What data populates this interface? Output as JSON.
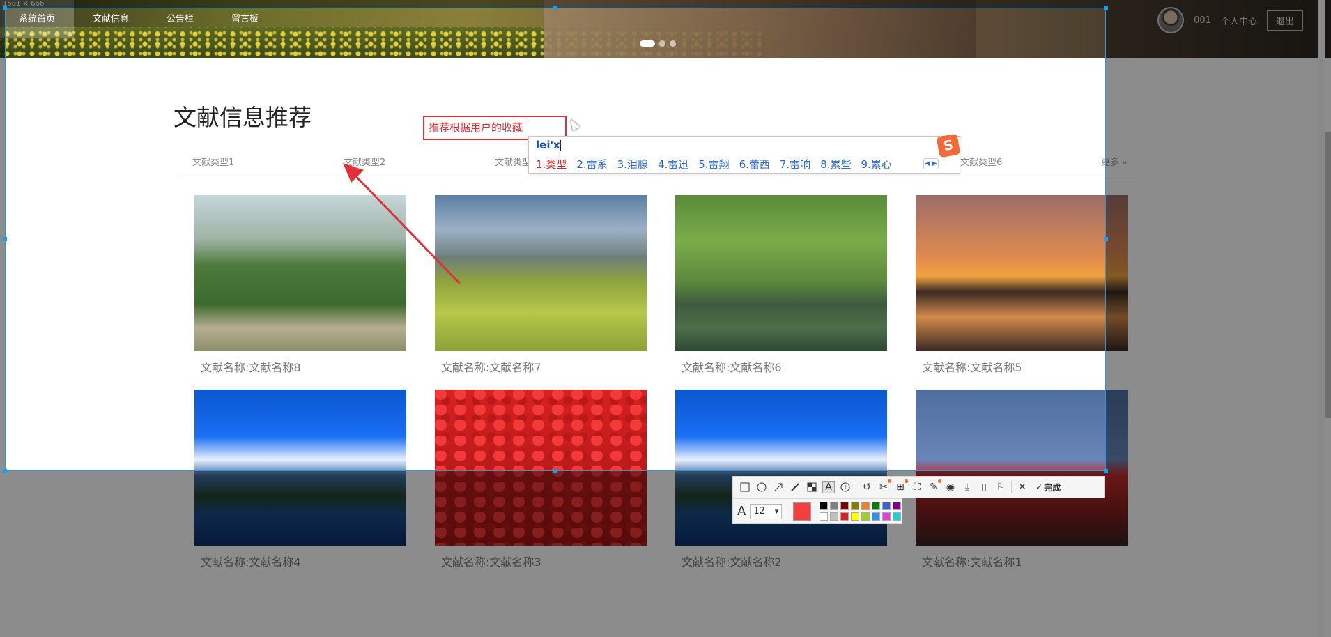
{
  "capture_size_label": "1581 × 666",
  "nav": {
    "items": [
      {
        "label": "系统首页",
        "active": true
      },
      {
        "label": "文献信息",
        "active": false
      },
      {
        "label": "公告栏",
        "active": false
      },
      {
        "label": "留言板",
        "active": false
      }
    ]
  },
  "user": {
    "id": "001",
    "center_label": "个人中心",
    "logout_label": "退出"
  },
  "section": {
    "title": "文献信息推荐"
  },
  "tabs": {
    "items": [
      "文献类型1",
      "文献类型2",
      "文献类型3",
      "文献类型6"
    ],
    "more_label": "更多 »"
  },
  "cards": [
    {
      "name": "文献名称:文献名称8",
      "image": "mountain-family"
    },
    {
      "name": "文献名称:文献名称7",
      "image": "rice-terrace"
    },
    {
      "name": "文献名称:文献名称6",
      "image": "willow-pond"
    },
    {
      "name": "文献名称:文献名称5",
      "image": "sunset-trees"
    },
    {
      "name": "文献名称:文献名称4",
      "image": "snow-mountain-lake"
    },
    {
      "name": "文献名称:文献名称3",
      "image": "red-leaves"
    },
    {
      "name": "文献名称:文献名称2",
      "image": "snow-mountain-lake"
    },
    {
      "name": "文献名称:文献名称1",
      "image": "red-peak"
    }
  ],
  "annotation": {
    "text": "推荐根据用户的收藏",
    "color": "#e0303a"
  },
  "ime": {
    "input": "lei'x",
    "candidates": [
      "1.类型",
      "2.雷系",
      "3.泪腺",
      "4.雷迅",
      "5.雷翔",
      "6.蕾西",
      "7.雷响",
      "8.累些",
      "9.累心"
    ],
    "logo": "S"
  },
  "capture_toolbar": {
    "tools": [
      "rectangle-icon",
      "ellipse-icon",
      "arrow-icon",
      "pen-icon",
      "mosaic-icon",
      "text-icon",
      "number-icon",
      "undo-icon",
      "pin-icon",
      "ocr-icon",
      "scroll-capture-icon",
      "translate-icon",
      "record-icon",
      "download-icon",
      "phone-icon",
      "bookmark-icon",
      "close-icon"
    ],
    "finish_label": "完成",
    "font_size": "12",
    "current_color": "#f24040",
    "palette": [
      "#000000",
      "#808080",
      "#800000",
      "#808000",
      "#f08030",
      "#008000",
      "#4060d0",
      "#800080",
      "#ffffff",
      "#c0c0c0",
      "#e02020",
      "#ffff00",
      "#a0d020",
      "#3090f0",
      "#e040e0",
      "#20d0d0"
    ],
    "accent": "#1a9cf0"
  }
}
